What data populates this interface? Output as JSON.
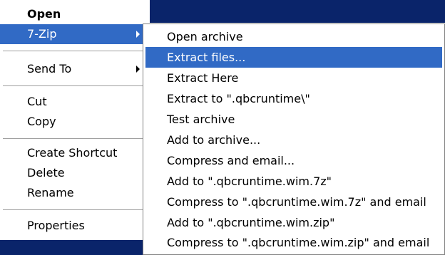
{
  "main_menu": {
    "items": [
      {
        "label": "Open"
      },
      {
        "label": "7-Zip"
      },
      {
        "label": "Send To"
      },
      {
        "label": "Cut"
      },
      {
        "label": "Copy"
      },
      {
        "label": "Create Shortcut"
      },
      {
        "label": "Delete"
      },
      {
        "label": "Rename"
      },
      {
        "label": "Properties"
      }
    ]
  },
  "submenu": {
    "items": [
      {
        "label": "Open archive"
      },
      {
        "label": "Extract files..."
      },
      {
        "label": "Extract Here"
      },
      {
        "label": "Extract to \".qbcruntime\\\""
      },
      {
        "label": "Test archive"
      },
      {
        "label": "Add to archive..."
      },
      {
        "label": "Compress and email..."
      },
      {
        "label": "Add to \".qbcruntime.wim.7z\""
      },
      {
        "label": "Compress to \".qbcruntime.wim.7z\" and email"
      },
      {
        "label": "Add to \".qbcruntime.wim.zip\""
      },
      {
        "label": "Compress to \".qbcruntime.wim.zip\" and email"
      }
    ]
  },
  "colors": {
    "highlight": "#316ac5",
    "desktop_selection": "#0a246a"
  }
}
